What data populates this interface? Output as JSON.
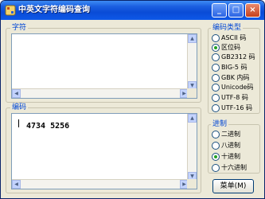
{
  "window": {
    "title": "中英文字符编码查询",
    "icon": "app-icon",
    "controls": {
      "minimize": "_",
      "maximize": "□",
      "close": "×"
    }
  },
  "chars_group": {
    "label": "字符",
    "value": ""
  },
  "code_group": {
    "label": "编码",
    "value": "4734 5256"
  },
  "encoding_group": {
    "label": "编码类型",
    "selected": "区位码",
    "options": [
      "ASCII 码",
      "区位码",
      "GB2312 码",
      "BIG-5 码",
      "GBK 内码",
      "Unicode码",
      "UTF-8 码",
      "UTF-16 码"
    ]
  },
  "radix_group": {
    "label": "进制",
    "selected": "十进制",
    "options": [
      "二进制",
      "八进制",
      "十进制",
      "十六进制"
    ]
  },
  "menu_button": {
    "label": "菜单(M)"
  },
  "colors": {
    "group_label": "#0046d5",
    "title_bar": "#0a4bd6",
    "radio_selected": "#21a121"
  }
}
